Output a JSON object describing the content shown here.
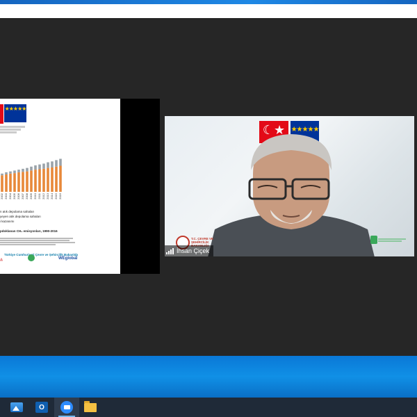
{
  "slide": {
    "legend_lines": [
      "n atık depolama sahaları",
      "yeyen atık depolama sahaları",
      "i kazanımı"
    ],
    "caption": "pdoklanan CH₄ emisyonları, 1990-2016",
    "ministry_line": "Türkiye Cumhuriyeti Çevre ve Şehircilik Bakanlığı",
    "logo_right": "WEglobal"
  },
  "chart_data": {
    "type": "bar",
    "categories": [
      "2002",
      "2003",
      "2004",
      "2005",
      "2006",
      "2007",
      "2008",
      "2009",
      "2010",
      "2011",
      "2012",
      "2013",
      "2014",
      "2015",
      "2016"
    ],
    "series": [
      {
        "name": "",
        "values": [
          38,
          40,
          42,
          43,
          45,
          46,
          47,
          49,
          51,
          52,
          53,
          55,
          56,
          58,
          60
        ]
      },
      {
        "name": "",
        "values": [
          4,
          5,
          5,
          6,
          6,
          7,
          8,
          9,
          10,
          11,
          12,
          13,
          14,
          15,
          16
        ]
      }
    ],
    "colors": [
      "#e8893a",
      "#9aa3aa"
    ],
    "title": "",
    "xlabel": "",
    "ylabel": ""
  },
  "video": {
    "participant_name": "İhsan Çiçek",
    "ministry_logo_text": "T.C. ÇEVRE VE ŞEHİRCİLİK BAKANLIĞI"
  },
  "taskbar": {
    "items": [
      {
        "icon": "photos-icon"
      },
      {
        "icon": "outlook-icon",
        "glyph": "O"
      },
      {
        "icon": "zoom-icon"
      },
      {
        "icon": "file-explorer-icon"
      }
    ]
  }
}
